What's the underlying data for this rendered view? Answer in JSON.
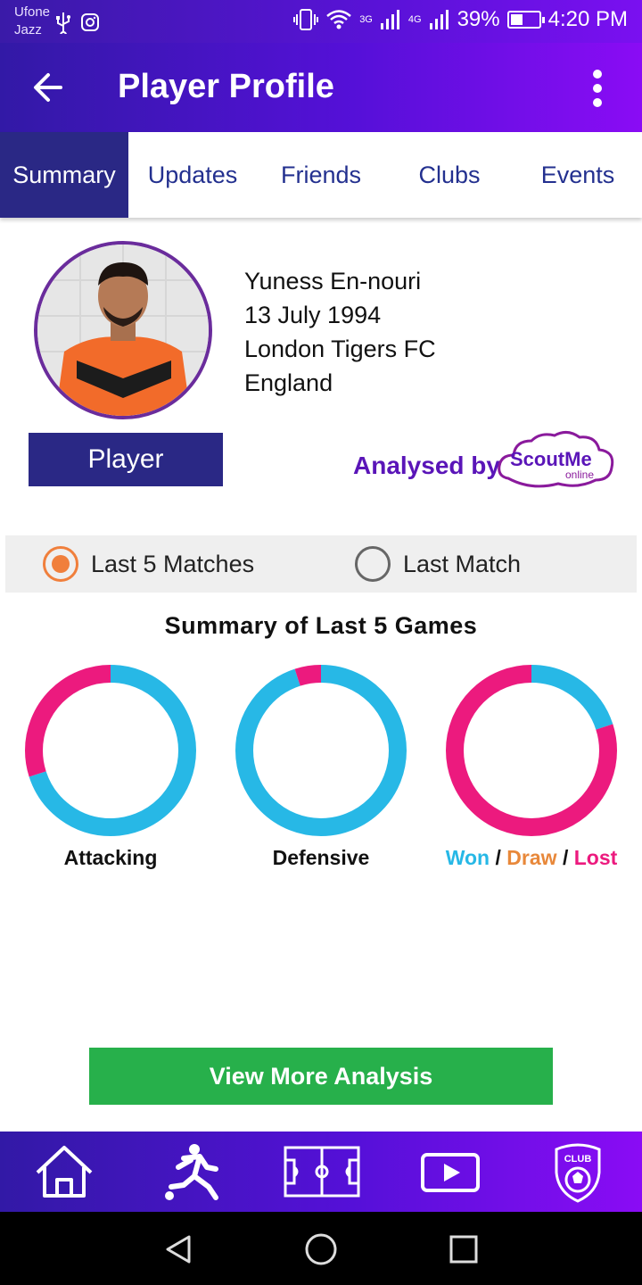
{
  "status_bar": {
    "carrier_line1": "Ufone",
    "carrier_line2": "Jazz",
    "net1": "3G",
    "net2": "4G",
    "battery": "39%",
    "time": "4:20 PM"
  },
  "app_bar": {
    "title": "Player Profile"
  },
  "tabs": [
    {
      "label": "Summary",
      "active": true
    },
    {
      "label": "Updates",
      "active": false
    },
    {
      "label": "Friends",
      "active": false
    },
    {
      "label": "Clubs",
      "active": false
    },
    {
      "label": "Events",
      "active": false
    }
  ],
  "profile": {
    "name": "Yuness En-nouri",
    "dob": "13 July 1994",
    "club": "London Tigers FC",
    "country": "England",
    "role": "Player",
    "analysed_by": "Analysed by",
    "logo_text_main": "ScoutMe",
    "logo_text_sub": "online"
  },
  "period_options": {
    "option1": "Last 5 Matches",
    "option2": "Last Match",
    "selected": "Last 5 Matches"
  },
  "summary": {
    "title": "Summary of Last 5 Games",
    "attacking_label": "Attacking",
    "defensive_label": "Defensive",
    "result_won": "Won",
    "result_draw": "Draw",
    "result_lost": "Lost",
    "separator": "/"
  },
  "chart_data": [
    {
      "type": "pie",
      "title": "Attacking",
      "values": [
        0.7,
        0.3
      ],
      "colors": [
        "#27b8e6",
        "#ec1a7e"
      ]
    },
    {
      "type": "pie",
      "title": "Defensive",
      "values": [
        0.95,
        0.05
      ],
      "colors": [
        "#27b8e6",
        "#ec1a7e"
      ]
    },
    {
      "type": "pie",
      "title": "Won / Draw / Lost",
      "values": [
        0.2,
        0.0,
        0.8
      ],
      "categories": [
        "Won",
        "Draw",
        "Lost"
      ],
      "colors": [
        "#27b8e6",
        "#e8883a",
        "#ec1a7e"
      ]
    }
  ],
  "actions": {
    "view_more": "View More Analysis"
  },
  "colors": {
    "primary": "#2a2885",
    "accent_cyan": "#27b8e6",
    "accent_pink": "#ec1a7e",
    "accent_orange": "#e8883a",
    "green": "#27b04b"
  },
  "bottom_nav": [
    "home-icon",
    "player-icon",
    "pitch-icon",
    "video-icon",
    "club-icon"
  ]
}
